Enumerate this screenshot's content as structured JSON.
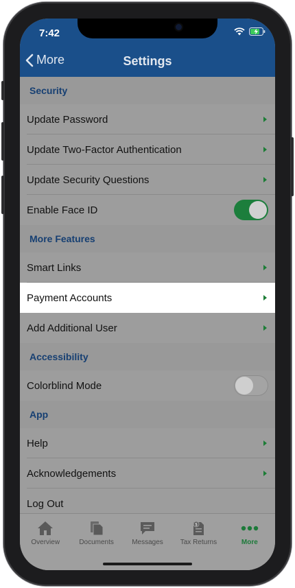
{
  "status_bar": {
    "time": "7:42"
  },
  "nav": {
    "back_label": "More",
    "title": "Settings"
  },
  "sections": [
    {
      "header": "Security",
      "rows": [
        {
          "label": "Update Password",
          "accessory": "chevron"
        },
        {
          "label": "Update Two-Factor Authentication",
          "accessory": "chevron"
        },
        {
          "label": "Update Security Questions",
          "accessory": "chevron"
        },
        {
          "label": "Enable Face ID",
          "accessory": "toggle",
          "toggle_on": true
        }
      ]
    },
    {
      "header": "More Features",
      "rows": [
        {
          "label": "Smart Links",
          "accessory": "chevron"
        },
        {
          "label": "Payment Accounts",
          "accessory": "chevron",
          "highlighted": true
        },
        {
          "label": "Add Additional User",
          "accessory": "chevron"
        }
      ]
    },
    {
      "header": "Accessibility",
      "rows": [
        {
          "label": "Colorblind Mode",
          "accessory": "toggle",
          "toggle_on": false
        }
      ]
    },
    {
      "header": "App",
      "rows": [
        {
          "label": "Help",
          "accessory": "chevron"
        },
        {
          "label": "Acknowledgements",
          "accessory": "chevron"
        },
        {
          "label": "Log Out",
          "accessory": "none"
        }
      ]
    }
  ],
  "tabbar": {
    "tabs": [
      {
        "label": "Overview",
        "icon": "home-icon",
        "active": false
      },
      {
        "label": "Documents",
        "icon": "documents-icon",
        "active": false
      },
      {
        "label": "Messages",
        "icon": "message-icon",
        "active": false
      },
      {
        "label": "Tax Returns",
        "icon": "tax-returns-icon",
        "active": false
      },
      {
        "label": "More",
        "icon": "more-dots-icon",
        "active": true
      }
    ]
  },
  "colors": {
    "nav_bar": "#1a4f8a",
    "accent_green": "#1c7d36",
    "section_header_text": "#163f72"
  }
}
